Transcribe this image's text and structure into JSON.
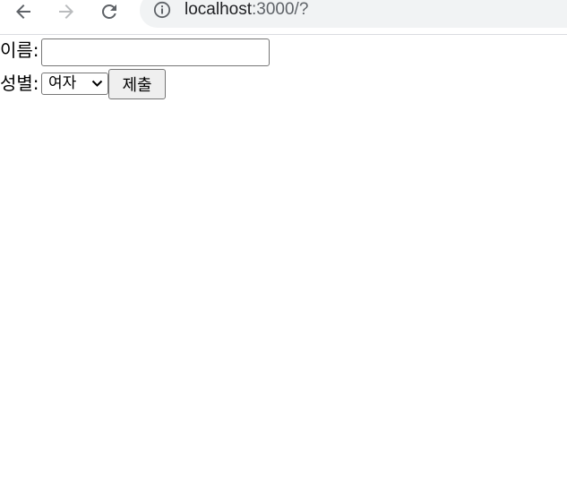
{
  "browser": {
    "url_host": "localhost",
    "url_rest": ":3000/?",
    "icons": {
      "back": "arrow-left-icon",
      "forward": "arrow-right-icon",
      "reload": "reload-icon",
      "info": "info-icon"
    },
    "colors": {
      "omnibox_bg": "#f1f3f4",
      "icon_active": "#5f6368",
      "icon_disabled": "#babcbe"
    }
  },
  "form": {
    "name_label": "이름:",
    "name_value": "",
    "gender_label": "성별:",
    "gender_selected": "여자",
    "submit_label": "제출"
  }
}
